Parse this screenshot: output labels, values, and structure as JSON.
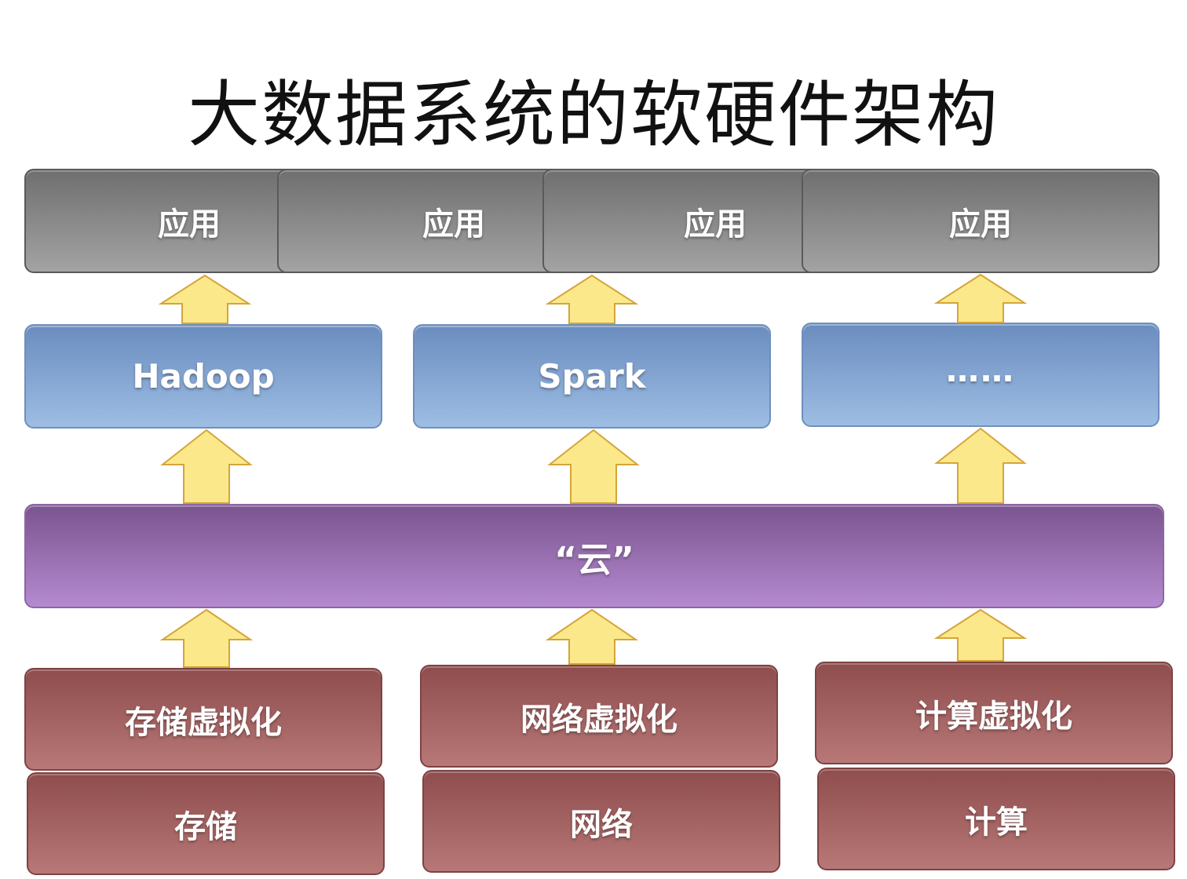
{
  "title": "大数据系统的软硬件架构",
  "applications": [
    "应用",
    "应用",
    "应用",
    "应用"
  ],
  "frameworks": [
    "Hadoop",
    "Spark",
    "……"
  ],
  "cloud": "“云”",
  "virtualization": [
    "存储虚拟化",
    "网络虚拟化",
    "计算虚拟化"
  ],
  "hardware": [
    "存储",
    "网络",
    "计算"
  ],
  "colors": {
    "application": "#8a8a8a",
    "framework": "#88a8d6",
    "cloud": "#9a70b5",
    "hardware": "#a66464",
    "arrow": "#fbe88a"
  }
}
